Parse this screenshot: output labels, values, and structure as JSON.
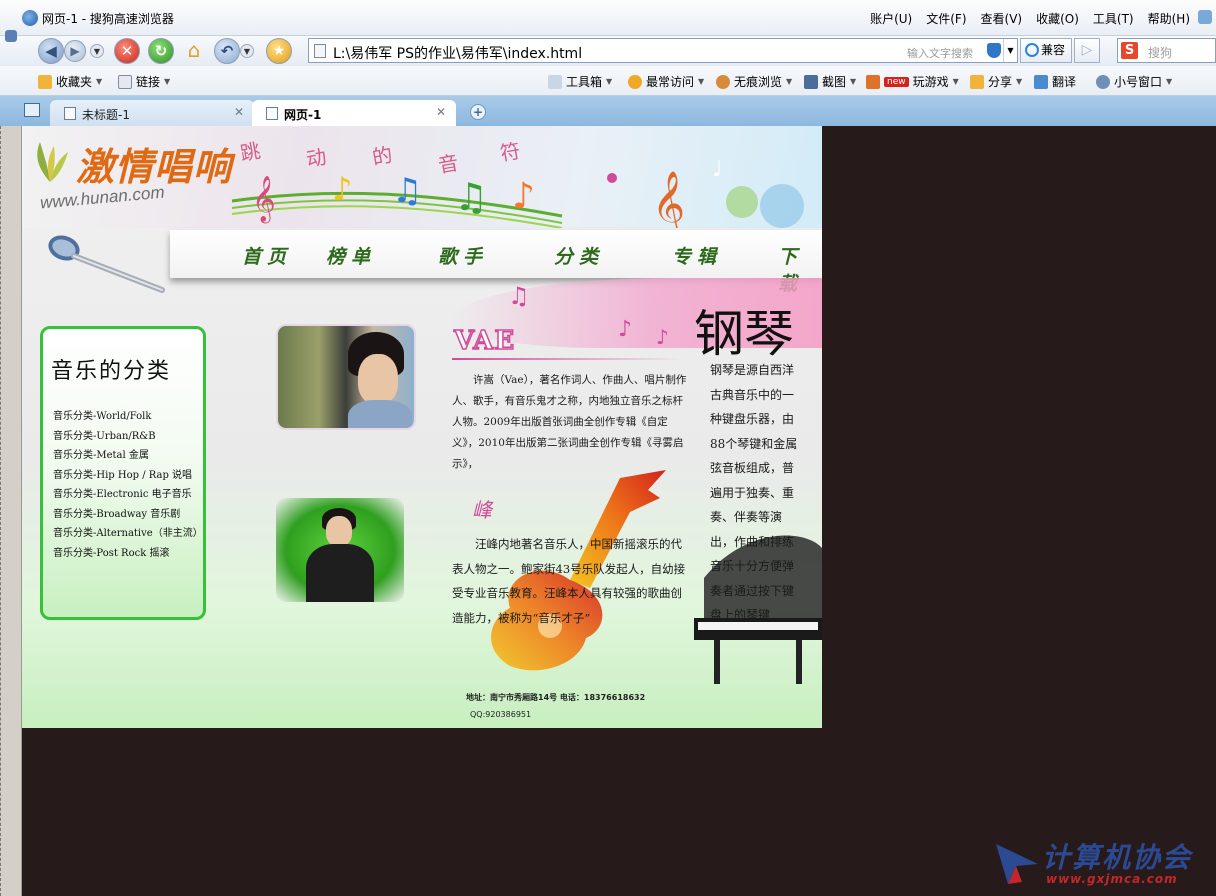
{
  "browser": {
    "window_title": "网页-1 - 搜狗高速浏览器",
    "menu": [
      "账户(U)",
      "文件(F)",
      "查看(V)",
      "收藏(O)",
      "工具(T)",
      "帮助(H)"
    ],
    "address_url": "L:\\易伟军 PS的作业\\易伟军\\index.html",
    "address_hint": "输入文字搜索",
    "compat_label": "兼容",
    "search_placeholder": "搜狗",
    "favorites": {
      "collect": "收藏夹",
      "links": "链接",
      "toolbox": "工具箱",
      "frequent": "最常访问",
      "private": "无痕浏览",
      "screenshot": "截图",
      "new_badge": "new",
      "games": "玩游戏",
      "share": "分享",
      "translate": "翻译",
      "small_window": "小号窗口"
    },
    "tabs": [
      {
        "label": "未标题-1",
        "active": false
      },
      {
        "label": "网页-1",
        "active": true
      }
    ]
  },
  "page": {
    "site_title": "激情唱响",
    "site_url": "www.hunan.com",
    "banner_words": [
      "跳",
      "动",
      "的",
      "音",
      "符"
    ],
    "nav": [
      "首页",
      "榜单",
      "歌手",
      "分类",
      "专辑",
      "下载"
    ],
    "sidebar": {
      "title": "音乐的分类",
      "categories": [
        "音乐分类-World/Folk",
        "音乐分类-Urban/R&B",
        "音乐分类-Metal 金属",
        "音乐分类-Hip Hop / Rap 说唱",
        "音乐分类-Electronic 电子音乐",
        "音乐分类-Broadway 音乐剧",
        "音乐分类-Alternative（非主流）",
        "音乐分类-Post Rock 摇滚"
      ]
    },
    "vae": {
      "title": "VAE",
      "text": "许嵩（Vae），著名作词人、作曲人、唱片制作人、歌手，有音乐鬼才之称，内地独立音乐之标杆人物。2009年出版首张词曲全创作专辑《自定义》，2010年出版第二张词曲全创作专辑《寻雾启示》，"
    },
    "feng": {
      "title": "峰",
      "text": "汪峰内地著名音乐人，中国新摇滚乐的代表人物之一。鲍家街43号乐队发起人，自幼接受专业音乐教育。汪峰本人具有较强的歌曲创造能力，被称为“音乐才子”"
    },
    "piano": {
      "title": "钢琴",
      "text": "钢琴是源自西洋古典音乐中的一种键盘乐器，由88个琴键和金属弦音板组成，普遍用于独奏、重奏、伴奏等演出，作曲和排练音乐十分方便弹奏者通过按下键盘上的琴键"
    },
    "footer": {
      "address": "地址：南宁市秀厢路14号   电话：18376618632",
      "qq": "QQ:920386951"
    }
  },
  "watermark": {
    "text": "计算机协会",
    "sub": "www.gxjmca.com"
  },
  "colors": {
    "nav_text": "#2e6a1c",
    "sidebar_border": "#36c13a",
    "accent_pink": "#d04a9a",
    "title_orange": "#e06a14",
    "viewport_bg": "#261a1a"
  }
}
